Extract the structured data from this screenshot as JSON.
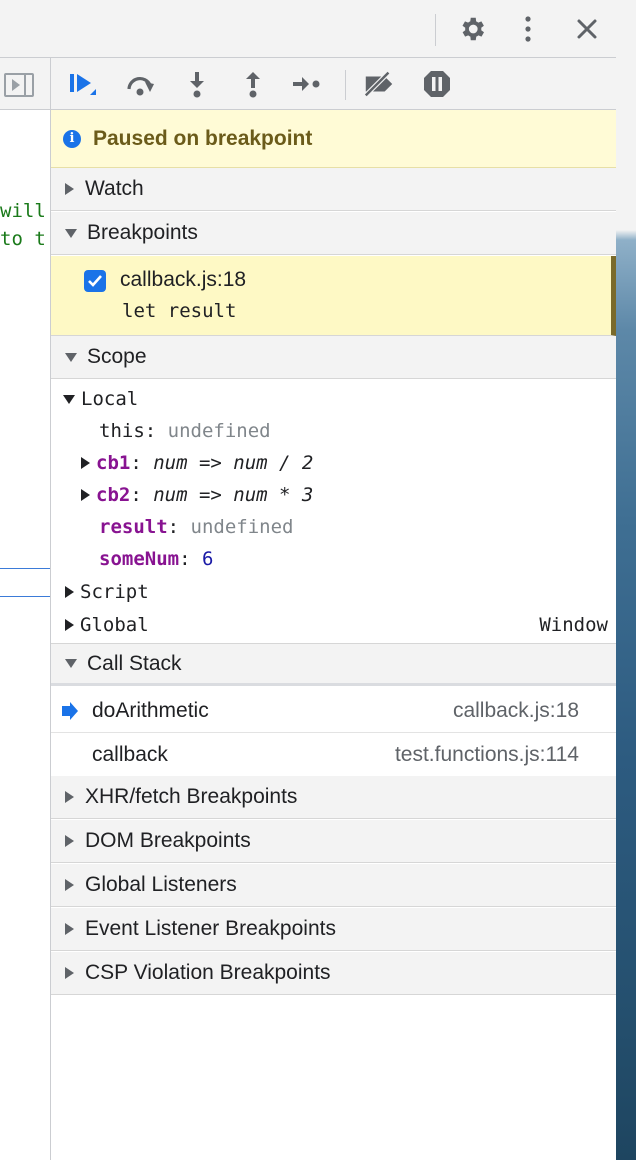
{
  "topbar": {
    "icons": [
      "gear-icon",
      "more-vertical-icon",
      "close-icon"
    ]
  },
  "source": {
    "lines": [
      "will",
      "to t"
    ]
  },
  "debugger_toolbar": {
    "buttons": [
      "resume-icon",
      "step-over-icon",
      "step-into-icon",
      "step-out-icon",
      "step-icon",
      "deactivate-breakpoints-icon",
      "pause-on-exceptions-icon"
    ]
  },
  "paused": {
    "text": "Paused on breakpoint"
  },
  "sections": {
    "watch": "Watch",
    "breakpoints": "Breakpoints",
    "scope": "Scope",
    "call_stack": "Call Stack",
    "xhr": "XHR/fetch Breakpoints",
    "dom": "DOM Breakpoints",
    "global_listeners": "Global Listeners",
    "event_listener": "Event Listener Breakpoints",
    "csp": "CSP Violation Breakpoints"
  },
  "breakpoint": {
    "file": "callback.js:18",
    "code": "let result",
    "checked": true
  },
  "scope": {
    "local_label": "Local",
    "vars": [
      {
        "key": "this",
        "sep": ": ",
        "value": "undefined"
      },
      {
        "key": "cb1",
        "sep": ": ",
        "value": "num => num / 2"
      },
      {
        "key": "cb2",
        "sep": ": ",
        "value": "num => num * 3"
      },
      {
        "key": "result",
        "sep": ": ",
        "value": "undefined"
      },
      {
        "key": "someNum",
        "sep": ": ",
        "value": "6"
      }
    ],
    "script_label": "Script",
    "global_label": "Global",
    "global_value": "Window"
  },
  "call_stack": [
    {
      "fn": "doArithmetic",
      "loc": "callback.js:18",
      "current": true
    },
    {
      "fn": "callback",
      "loc": "test.functions.js:114",
      "current": false
    }
  ]
}
